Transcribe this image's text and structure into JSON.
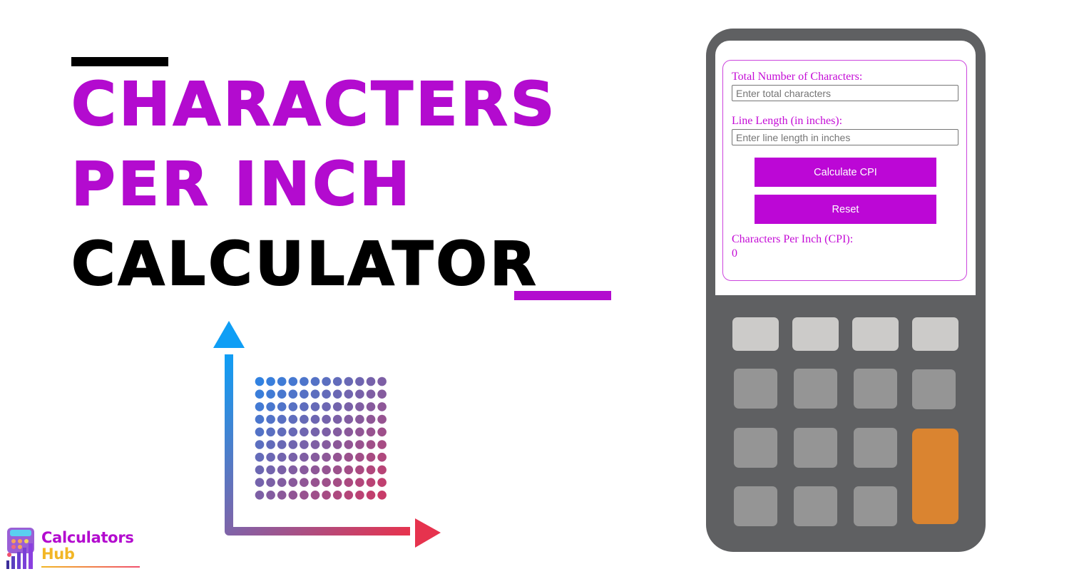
{
  "title": {
    "line1": "Characters",
    "line2": "Per Inch",
    "line3": "Calculator",
    "accent_color": "#b30bcf",
    "dark_color": "#000000"
  },
  "illustration": {
    "description": "dot grid between y-axis and x-axis arrows",
    "rows": 10,
    "cols": 12,
    "gradient_start": "#1a9cf0",
    "gradient_end": "#e5334f"
  },
  "logo": {
    "word1": "Calculators",
    "word2": "Hub"
  },
  "calculator": {
    "fields": [
      {
        "label": "Total Number of Characters:",
        "placeholder": "Enter total characters",
        "value": ""
      },
      {
        "label": "Line Length (in inches):",
        "placeholder": "Enter line length in inches",
        "value": ""
      }
    ],
    "buttons": {
      "calculate": "Calculate CPI",
      "reset": "Reset"
    },
    "result": {
      "label": "Characters Per Inch (CPI):",
      "value": "0"
    },
    "colors": {
      "body": "#5f6062",
      "button": "#bc07d6",
      "key_light": "#cccbc9",
      "key_mid": "#959595",
      "key_equals": "#da8430"
    }
  }
}
